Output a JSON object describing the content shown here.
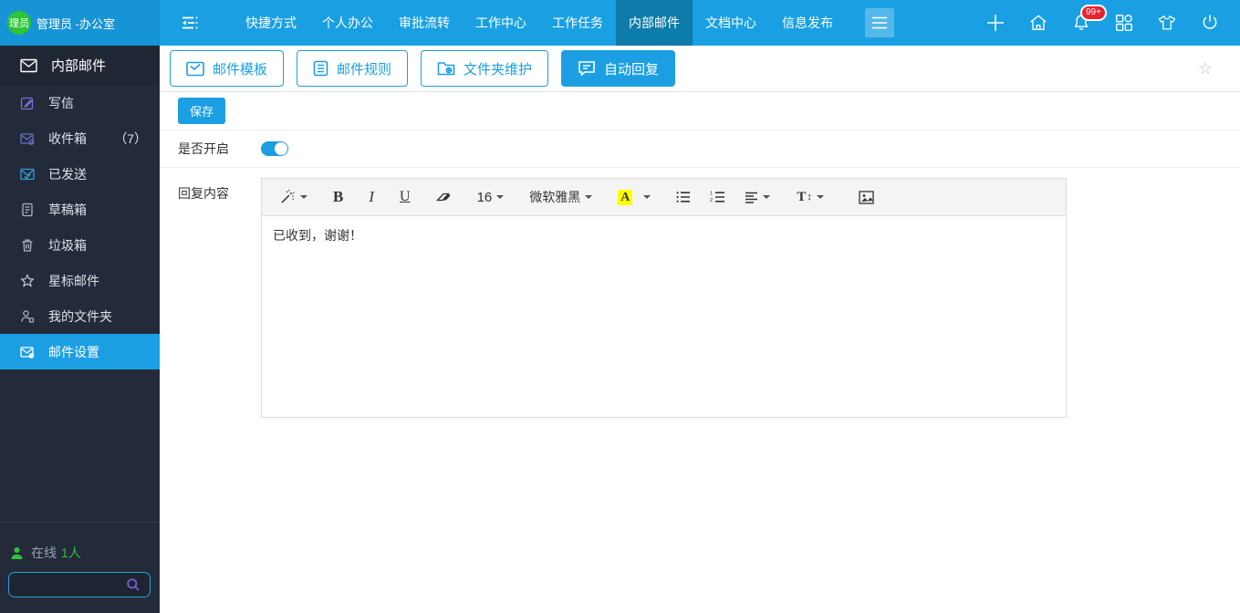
{
  "topbar": {
    "avatar_text": "理员",
    "username": "管理员 -办公室",
    "nav_items": [
      {
        "label": "快捷方式"
      },
      {
        "label": "个人办公"
      },
      {
        "label": "审批流转"
      },
      {
        "label": "工作中心"
      },
      {
        "label": "工作任务"
      },
      {
        "label": "内部邮件",
        "active": true
      },
      {
        "label": "文档中心"
      },
      {
        "label": "信息发布"
      }
    ],
    "notification_badge": "99+"
  },
  "sidebar": {
    "title": "内部邮件",
    "items": [
      {
        "label": "写信"
      },
      {
        "label": "收件箱",
        "count": "（7）"
      },
      {
        "label": "已发送"
      },
      {
        "label": "草稿箱"
      },
      {
        "label": "垃圾箱"
      },
      {
        "label": "星标邮件"
      },
      {
        "label": "我的文件夹"
      },
      {
        "label": "邮件设置",
        "active": true
      }
    ],
    "online_label": "在线",
    "online_count": "1人"
  },
  "settings_tabs": [
    {
      "label": "邮件模板"
    },
    {
      "label": "邮件规则"
    },
    {
      "label": "文件夹维护"
    },
    {
      "label": "自动回复",
      "active": true
    }
  ],
  "form": {
    "save_label": "保存",
    "toggle_label": "是否开启",
    "toggle_state": "on",
    "content_label": "回复内容",
    "editor": {
      "bold": "B",
      "italic": "I",
      "underline": "U",
      "font_size": "16",
      "font_name": "微软雅黑",
      "color_letter": "A",
      "lineheight_letter": "T",
      "updown_arrow": "↕",
      "content": "已收到，谢谢！"
    }
  },
  "fav_star": "☆",
  "colors": {
    "primary_blue": "#1b9fe2",
    "topbar_left_blue": "#1794d6",
    "active_nav_tab": "#0d7cab",
    "sidebar_bg": "#232b3a",
    "badge_red": "#e8222d",
    "online_green": "#2dc437",
    "highlight_yellow": "#ffff00"
  }
}
